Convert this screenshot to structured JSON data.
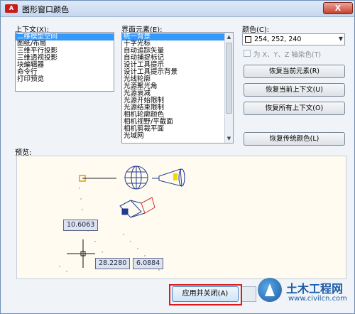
{
  "window": {
    "app_icon": "A",
    "title": "图形窗口颜色",
    "close": "X"
  },
  "context": {
    "label": "上下文(X):",
    "items": [
      "二维模型空间",
      "图纸/布局",
      "三维平行投影",
      "三维透视投影",
      "块编辑器",
      "命令行",
      "打印预览"
    ],
    "selected_index": 0
  },
  "elements": {
    "label": "界面元素(E):",
    "items": [
      "统一背景",
      "十字光标",
      "自动追踪矢量",
      "自动捕捉标记",
      "设计工具提示",
      "设计工具提示背景",
      "光线轮廓",
      "光源聚光角",
      "光源衰减",
      "光源开始限制",
      "光源结束限制",
      "相机轮廓颜色",
      "相机视野/平截面",
      "相机剪裁平面",
      "光域网"
    ],
    "selected_index": 0
  },
  "color": {
    "label": "颜色(C):",
    "value": "254, 252, 240",
    "swatch": "#fef6f0"
  },
  "tint_option": {
    "label": "为 X、Y、Z 轴染色(T)",
    "checked": false
  },
  "buttons": {
    "restore_element": "恢复当前元素(R)",
    "restore_context": "恢复当前上下文(U)",
    "restore_all": "恢复所有上下文(O)",
    "restore_classic": "恢复传统颜色(L)",
    "apply_close": "应用并关闭(A)"
  },
  "preview": {
    "label": "预览:",
    "tag1": "10.6063",
    "tag2": "28.2280",
    "tag3": "6.0884"
  },
  "watermark": {
    "title": "土木工程网",
    "url": "www.civilcn.com"
  },
  "colors": {
    "selection": "#3399ff",
    "highlight": "#e01818",
    "close": "#c8412b"
  }
}
